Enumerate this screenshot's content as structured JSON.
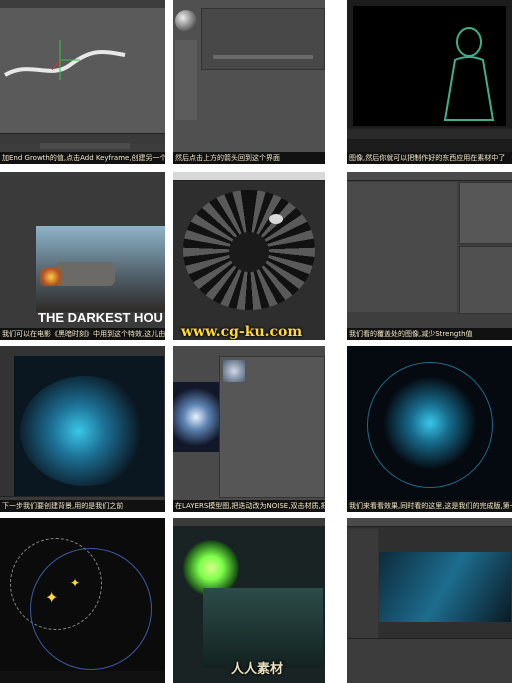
{
  "tiles": [
    {
      "caption": "加End Growth的值,点击Add Keyframe,创建另一个Keyf"
    },
    {
      "caption": "然后点击上方的箭头回到这个界面"
    },
    {
      "caption": "图像,然后你就可以把制作好的东西应用在素材中了"
    },
    {
      "caption": "我们可以在电影《黑暗时刻》中用到这个特效,这儿由行",
      "overlay_title": "THE DARKEST HOU"
    },
    {
      "caption": "",
      "watermark": "www.cg-ku.com"
    },
    {
      "caption": "我们看的覆盖处的图像,减少Strength值"
    },
    {
      "caption": "下一步我们要创建背景,用的是我们之前"
    },
    {
      "caption": "在LAYERS模型图,把迭动改为NOISE,双击材质,把黑色"
    },
    {
      "caption": "我们来看看效果,同时看的这里,这是我们的完成版,第一"
    },
    {
      "caption": ""
    },
    {
      "caption": "",
      "watermark": "人人素材"
    },
    {
      "caption": ""
    }
  ],
  "colors": {
    "caption_text": "#f2e9c9",
    "watermark": "#ffd83a",
    "accent_red": "#c94a3a",
    "glow_cyan": "#39c6e8",
    "glow_green": "#7cff4a"
  }
}
